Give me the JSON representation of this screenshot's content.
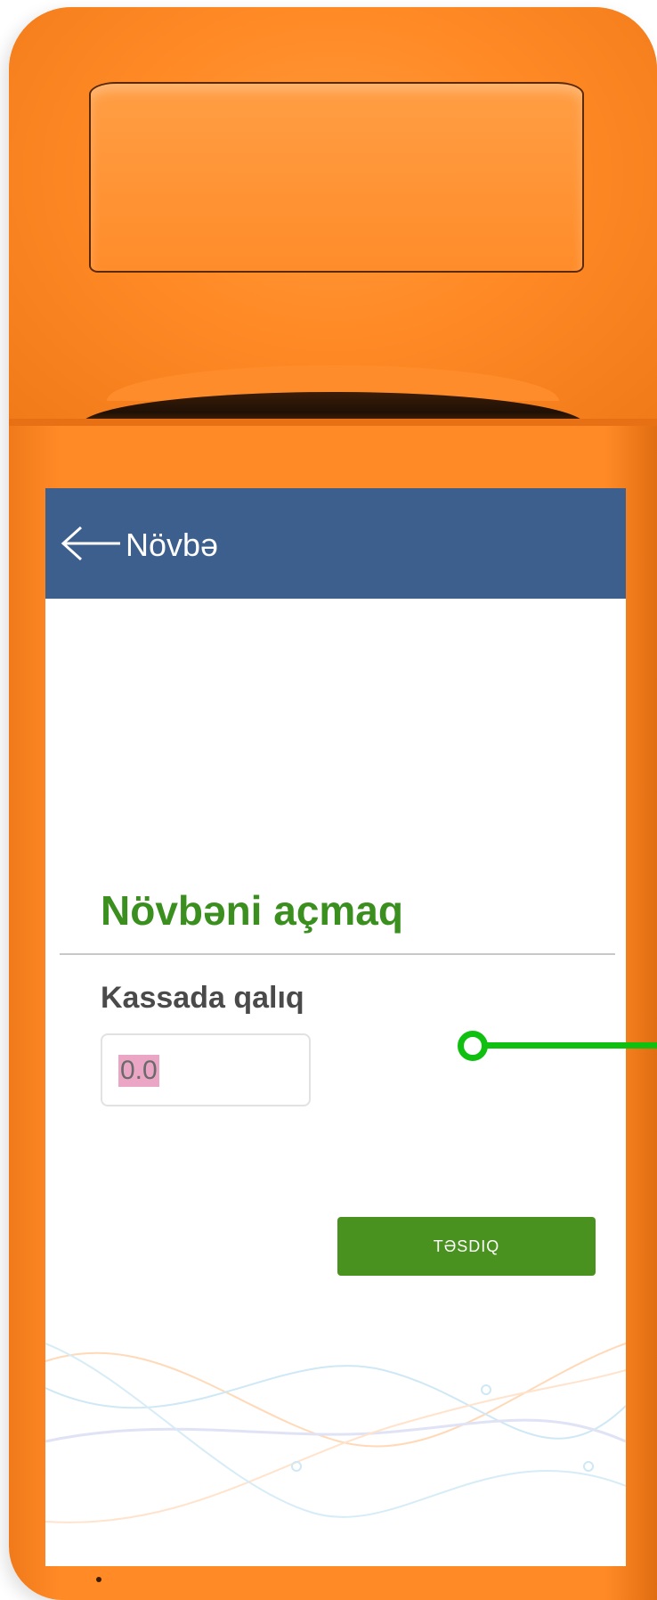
{
  "appbar": {
    "title": "Növbə",
    "back_icon": "arrow-left-icon"
  },
  "form": {
    "title": "Növbəni açmaq",
    "field_label": "Kassada qalıq",
    "field_value": "0.0",
    "confirm_label": "TƏSDIQ"
  },
  "colors": {
    "device": "#ff8a26",
    "appbar": "#3d5f8e",
    "title_green": "#3a8f1f",
    "button_green": "#4a921f",
    "marker": "#10c010"
  }
}
